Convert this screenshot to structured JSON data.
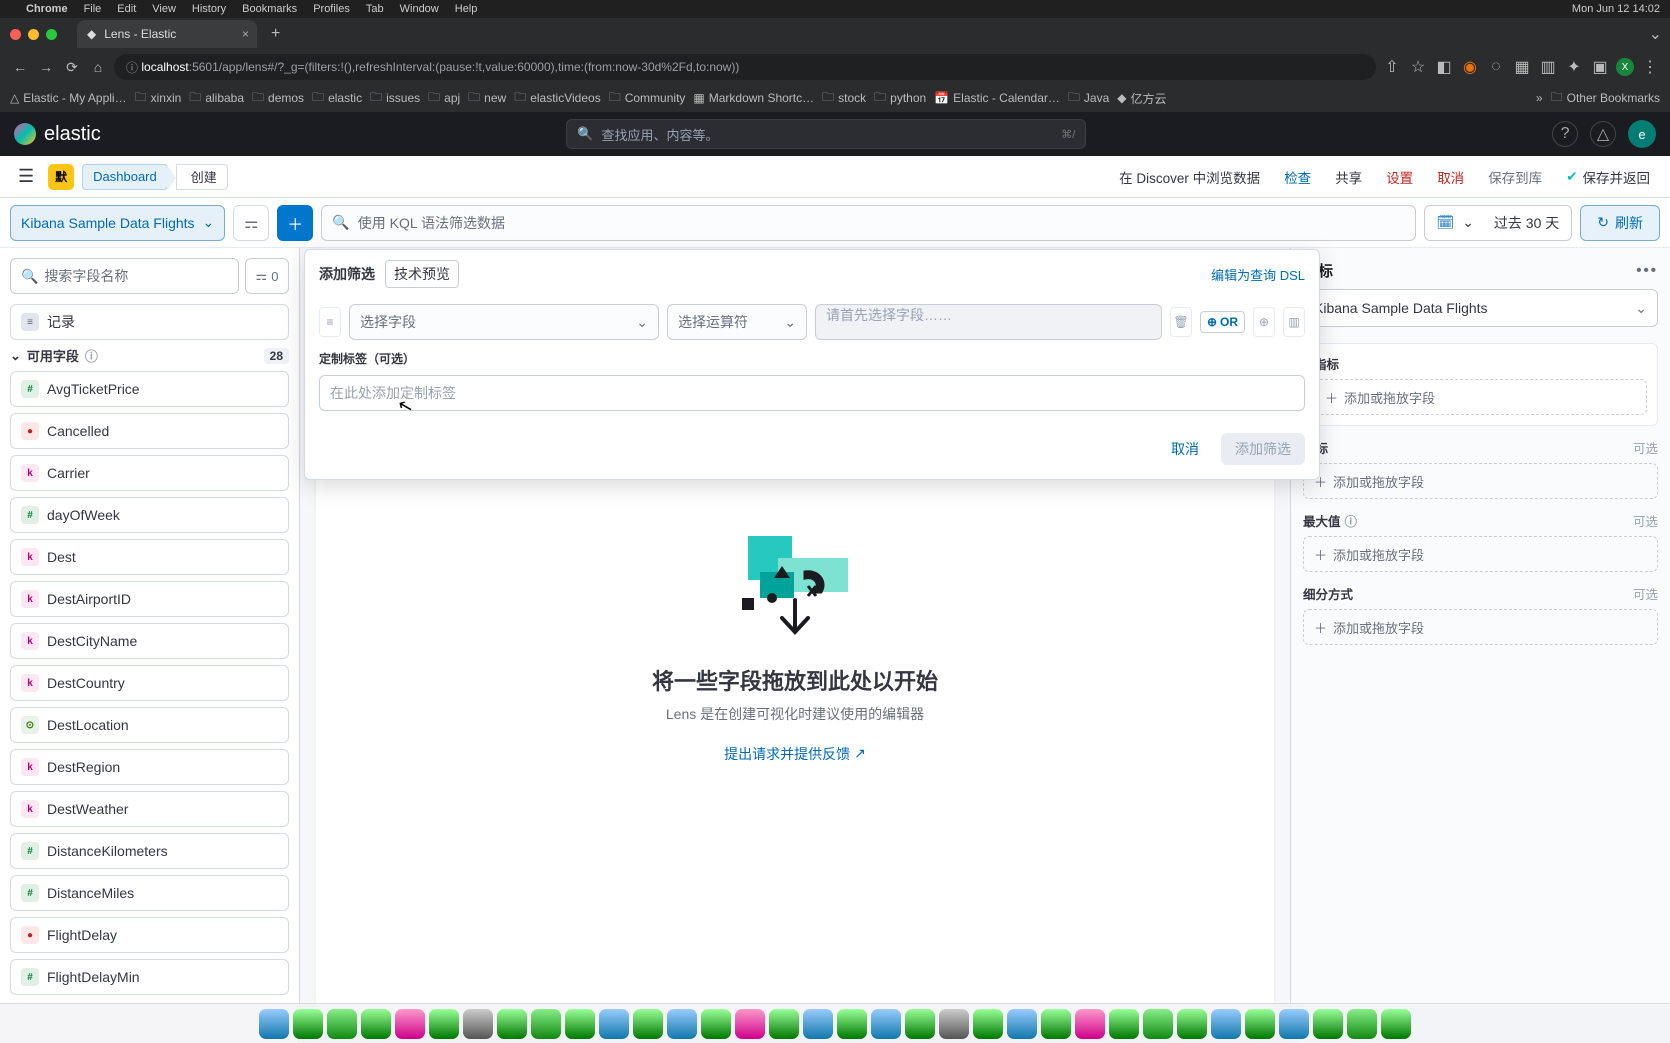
{
  "mac_menu": {
    "app": "Chrome",
    "items": [
      "File",
      "Edit",
      "View",
      "History",
      "Bookmarks",
      "Profiles",
      "Tab",
      "Window",
      "Help"
    ],
    "clock": "Mon Jun 12  14:02"
  },
  "tab": {
    "title": "Lens - Elastic"
  },
  "url": {
    "host": "localhost",
    "path": ":5601/app/lens#/?_g=(filters:!(),refreshInterval:(pause:!t,value:60000),time:(from:now-30d%2Fd,to:now))"
  },
  "bookmarks": [
    "Elastic - My Appli…",
    "xinxin",
    "alibaba",
    "demos",
    "elastic",
    "issues",
    "apj",
    "new",
    "elasticVideos",
    "Community",
    "Markdown Shortc…",
    "stock",
    "python",
    "Elastic - Calendar…",
    "Java",
    "亿方云"
  ],
  "bookmarks_other": "Other Bookmarks",
  "kbn": {
    "logo": "elastic",
    "search_placeholder": "查找应用、内容等。",
    "search_kbd": "⌘/",
    "avatar": "e"
  },
  "breadcrumb": {
    "space": "默",
    "dashboard": "Dashboard",
    "create": "创建"
  },
  "subheader": {
    "discover": "在 Discover 中浏览数据",
    "inspect": "检查",
    "share": "共享",
    "settings": "设置",
    "cancel": "取消",
    "saveLib": "保存到库",
    "saveReturn": "保存并返回"
  },
  "query": {
    "data_view": "Kibana Sample Data Flights",
    "kql_placeholder": "使用 KQL 语法筛选数据",
    "date": "过去 30 天",
    "refresh": "刷新"
  },
  "left": {
    "search_placeholder": "搜索字段名称",
    "filter_count": "0",
    "record": "记录",
    "available": "可用字段",
    "available_count": "28",
    "fields": [
      {
        "t": "n",
        "name": "AvgTicketPrice"
      },
      {
        "t": "b",
        "name": "Cancelled"
      },
      {
        "t": "k",
        "name": "Carrier"
      },
      {
        "t": "n",
        "name": "dayOfWeek"
      },
      {
        "t": "k",
        "name": "Dest"
      },
      {
        "t": "k",
        "name": "DestAirportID"
      },
      {
        "t": "k",
        "name": "DestCityName"
      },
      {
        "t": "k",
        "name": "DestCountry"
      },
      {
        "t": "g",
        "name": "DestLocation"
      },
      {
        "t": "k",
        "name": "DestRegion"
      },
      {
        "t": "k",
        "name": "DestWeather"
      },
      {
        "t": "n",
        "name": "DistanceKilometers"
      },
      {
        "t": "n",
        "name": "DistanceMiles"
      },
      {
        "t": "b",
        "name": "FlightDelay"
      },
      {
        "t": "n",
        "name": "FlightDelayMin"
      }
    ]
  },
  "canvas": {
    "title": "将一些字段拖放到此处以开始",
    "subtitle": "Lens 是在创建可视化时建议使用的编辑器",
    "feedback": "提出请求并提供反馈"
  },
  "right": {
    "title": "指标",
    "data_view": "Kibana Sample Data Flights",
    "groups": [
      {
        "label": "指标",
        "opt": "",
        "slot": "添加或拖放字段"
      },
      {
        "label": "指标",
        "opt": "可选",
        "slot": "添加或拖放字段"
      },
      {
        "label": "最大值",
        "opt": "可选",
        "slot": "添加或拖放字段"
      },
      {
        "label": "细分方式",
        "opt": "可选",
        "slot": "添加或拖放字段"
      }
    ]
  },
  "popover": {
    "tab1": "添加筛选",
    "tab2": "技术预览",
    "dsl": "编辑为查询 DSL",
    "select_field": "选择字段",
    "select_op": "选择运算符",
    "value_placeholder": "请首先选择字段……",
    "or": "OR",
    "custom_label": "定制标签（可选）",
    "custom_placeholder": "在此处添加定制标签",
    "cancel": "取消",
    "add": "添加筛选"
  }
}
